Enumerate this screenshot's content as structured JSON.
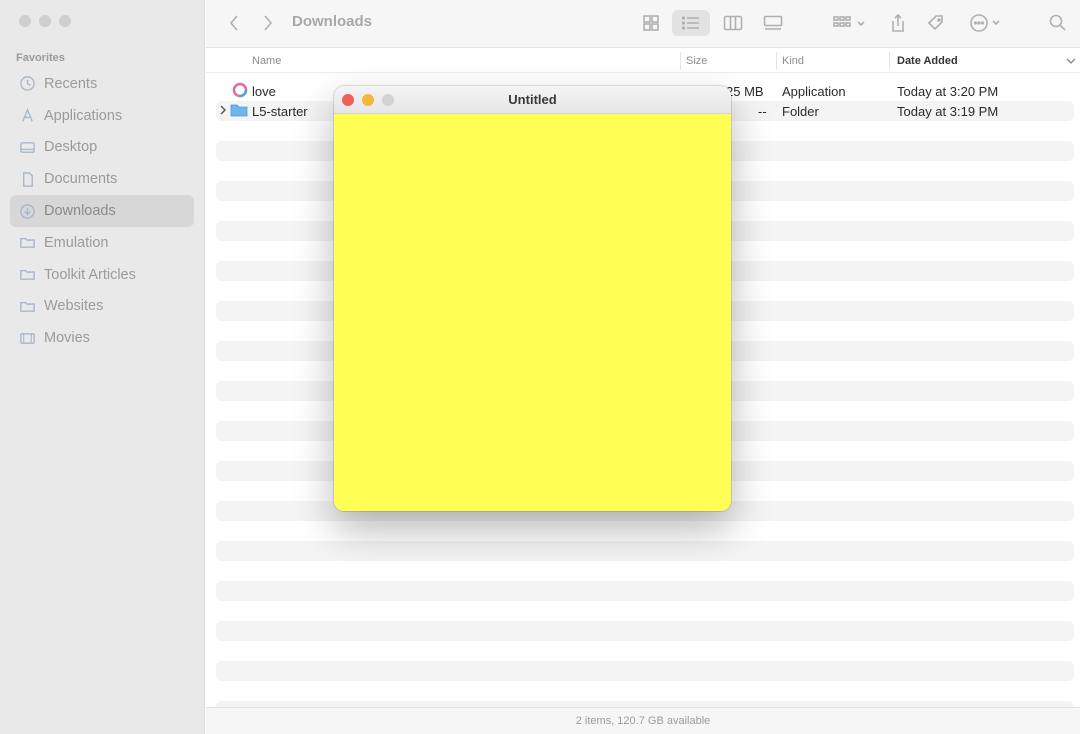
{
  "sidebar": {
    "section": "Favorites",
    "items": [
      {
        "label": "Recents",
        "icon": "clock-icon"
      },
      {
        "label": "Applications",
        "icon": "applications-icon"
      },
      {
        "label": "Desktop",
        "icon": "desktop-icon"
      },
      {
        "label": "Documents",
        "icon": "document-icon"
      },
      {
        "label": "Downloads",
        "icon": "download-icon",
        "active": true
      },
      {
        "label": "Emulation",
        "icon": "folder-icon"
      },
      {
        "label": "Toolkit Articles",
        "icon": "folder-icon"
      },
      {
        "label": "Websites",
        "icon": "folder-icon"
      },
      {
        "label": "Movies",
        "icon": "film-icon"
      }
    ]
  },
  "toolbar": {
    "title": "Downloads"
  },
  "columns": {
    "name": "Name",
    "size": "Size",
    "kind": "Kind",
    "date": "Date Added"
  },
  "files": [
    {
      "name": "love",
      "size": "25 MB",
      "kind": "Application",
      "date": "Today at 3:20 PM",
      "icon": "app-icon"
    },
    {
      "name": "L5-starter",
      "size": "--",
      "kind": "Folder",
      "date": "Today at 3:19 PM",
      "icon": "folder-icon"
    }
  ],
  "status": "2 items, 120.7 GB available",
  "popup": {
    "title": "Untitled",
    "background": "#ffff55",
    "lights": [
      "#ee5f57",
      "#f2b73d",
      "#cccccc"
    ]
  }
}
